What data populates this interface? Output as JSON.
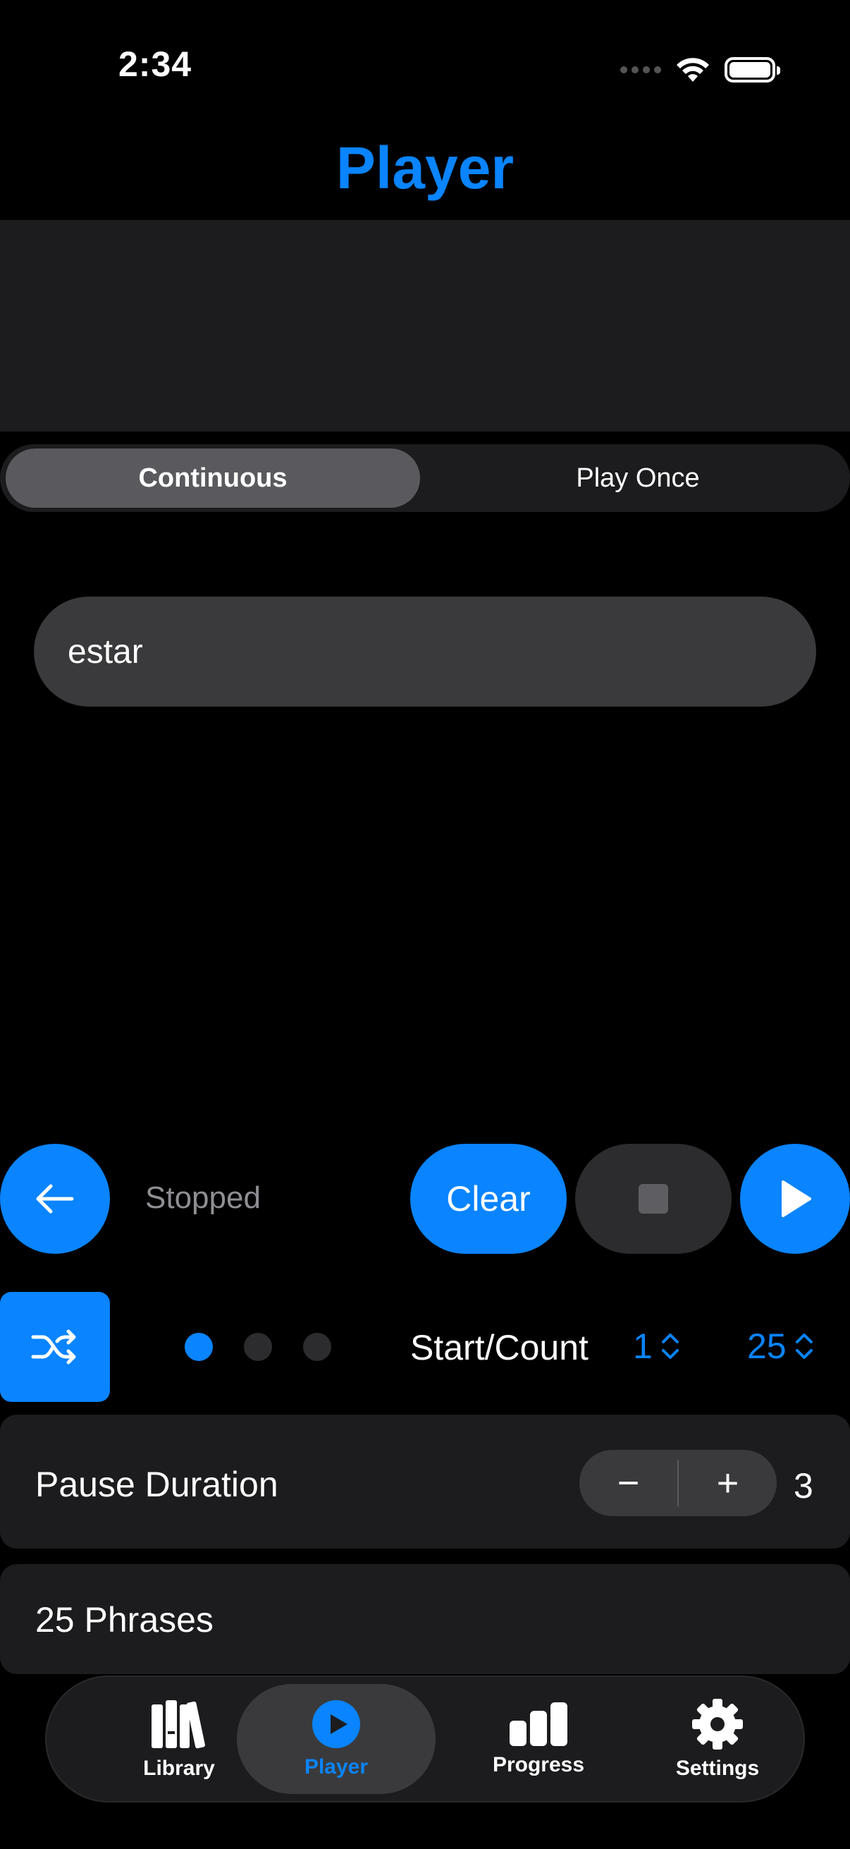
{
  "status_bar": {
    "time": "2:34"
  },
  "nav": {
    "title": "Player"
  },
  "segmented": {
    "continuous": "Continuous",
    "play_once": "Play Once",
    "selected": "Continuous"
  },
  "input": {
    "value": "estar"
  },
  "controls": {
    "status": "Stopped",
    "clear_label": "Clear",
    "back_icon": "arrow-left-icon",
    "stop_icon": "stop-icon",
    "play_icon": "play-icon",
    "shuffle_icon": "shuffle-icon"
  },
  "page_dots": {
    "count": 3,
    "active": 1
  },
  "start_count": {
    "label": "Start/Count",
    "start": "1",
    "count": "25"
  },
  "pause": {
    "label": "Pause Duration",
    "value": "3",
    "minus": "−",
    "plus": "+"
  },
  "phrases": {
    "label": "25 Phrases"
  },
  "tabs": [
    {
      "label": "Library",
      "icon": "books-icon"
    },
    {
      "label": "Player",
      "icon": "play-circle-icon",
      "active": true
    },
    {
      "label": "Progress",
      "icon": "bar-chart-icon"
    },
    {
      "label": "Settings",
      "icon": "gear-icon"
    }
  ],
  "colors": {
    "accent": "#0a84ff",
    "background": "#000000",
    "card": "#1c1c1e"
  }
}
